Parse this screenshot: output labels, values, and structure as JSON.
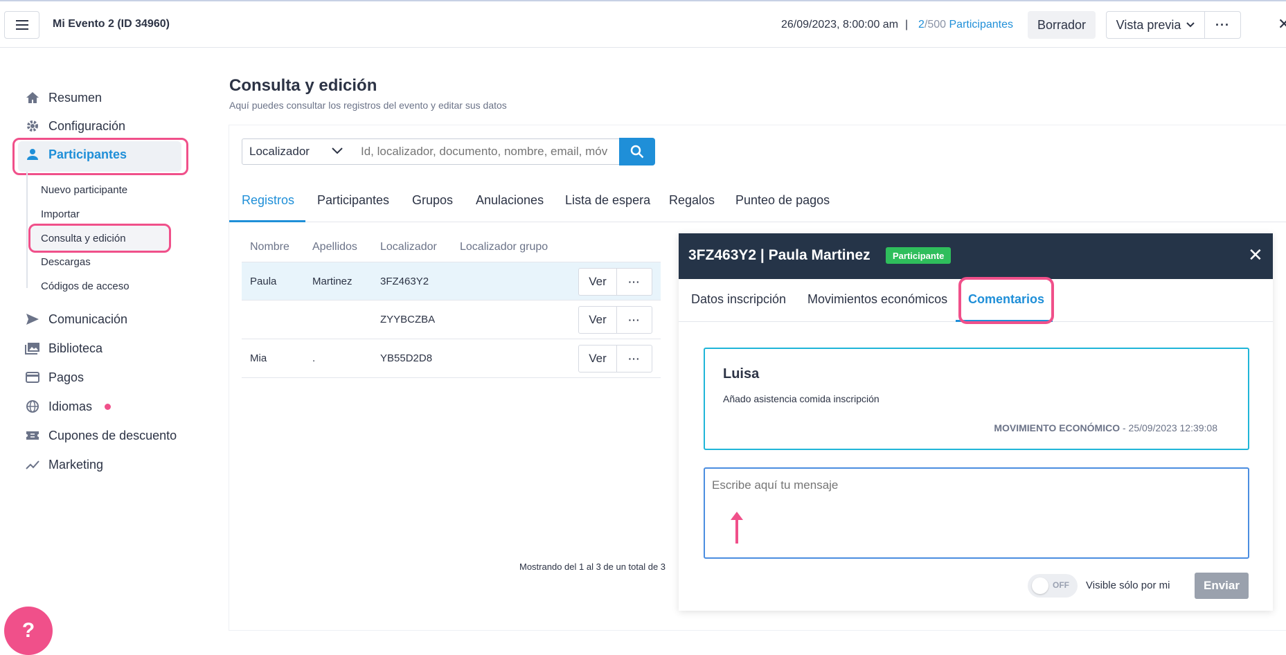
{
  "header": {
    "event_title": "Mi Evento 2 (ID 34960)",
    "event_date": "26/09/2023, 8:00:00 am",
    "separator": "|",
    "participants_current": "2",
    "participants_max": "/500",
    "participants_label": "Participantes",
    "draft_label": "Borrador",
    "preview_label": "Vista previa"
  },
  "sidebar": {
    "items": [
      {
        "label": "Resumen",
        "icon": "home-icon"
      },
      {
        "label": "Configuración",
        "icon": "gear-icon"
      },
      {
        "label": "Participantes",
        "icon": "person-icon"
      },
      {
        "label": "Comunicación",
        "icon": "send-icon"
      },
      {
        "label": "Biblioteca",
        "icon": "library-icon"
      },
      {
        "label": "Pagos",
        "icon": "card-icon"
      },
      {
        "label": "Idiomas",
        "icon": "globe-icon"
      },
      {
        "label": "Cupones de descuento",
        "icon": "ticket-icon"
      },
      {
        "label": "Marketing",
        "icon": "trend-icon"
      }
    ],
    "sub_items": [
      "Nuevo participante",
      "Importar",
      "Consulta y edición",
      "Descargas",
      "Códigos de acceso"
    ],
    "help_label": "?"
  },
  "main": {
    "title": "Consulta y edición",
    "subtitle": "Aquí puedes consultar los registros del evento y editar sus datos",
    "search": {
      "select_value": "Localizador",
      "placeholder": "Id, localizador, documento, nombre, email, móv"
    },
    "tabs": [
      "Registros",
      "Participantes",
      "Grupos",
      "Anulaciones",
      "Lista de espera",
      "Regalos",
      "Punteo de pagos"
    ],
    "table": {
      "headers": [
        "Nombre",
        "Apellidos",
        "Localizador",
        "Localizador grupo"
      ],
      "rows": [
        {
          "nombre": "Paula",
          "apellidos": "Martinez",
          "localizador": "3FZ463Y2",
          "grupo": ""
        },
        {
          "nombre": "",
          "apellidos": "",
          "localizador": "ZYYBCZBA",
          "grupo": ""
        },
        {
          "nombre": "Mia",
          "apellidos": ".",
          "localizador": "YB55D2D8",
          "grupo": ""
        }
      ],
      "view_label": "Ver"
    },
    "pagination_info": "Mostrando del 1 al 3 de un total de 3"
  },
  "detail": {
    "title": "3FZ463Y2 | Paula Martinez",
    "badge": "Participante",
    "tabs": [
      "Datos inscripción",
      "Movimientos económicos",
      "Comentarios"
    ],
    "comment": {
      "author": "Luisa",
      "text": "Añado asistencia comida inscripción",
      "type": "MOVIMIENTO ECONÓMICO",
      "date": " - 25/09/2023 12:39:08"
    },
    "message_placeholder": "Escribe aquí tu mensaje",
    "toggle_label": "OFF",
    "visible_label": "Visible sólo por mi",
    "send_label": "Enviar"
  },
  "colors": {
    "accent": "#1f8fd8",
    "highlight": "#f0508a",
    "header_dark": "#253448",
    "badge_green": "#2fbe5c"
  }
}
